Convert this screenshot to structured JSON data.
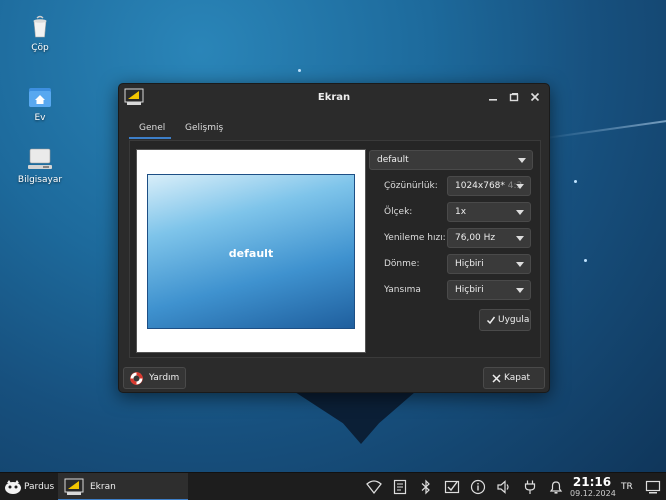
{
  "desktop": {
    "icons": [
      {
        "label": "Çöp",
        "icon": "trash-icon"
      },
      {
        "label": "Ev",
        "icon": "home-folder-icon"
      },
      {
        "label": "Bilgisayar",
        "icon": "computer-icon"
      }
    ]
  },
  "window": {
    "title": "Ekran",
    "tabs": [
      {
        "label": "Genel",
        "active": true
      },
      {
        "label": "Gelişmiş",
        "active": false
      }
    ],
    "preview": {
      "monitor_label": "default"
    },
    "monitor_select": {
      "value": "default"
    },
    "settings": [
      {
        "label": "Çözünürlük:",
        "value": "1024x768*",
        "extra": "4:3"
      },
      {
        "label": "Ölçek:",
        "value": "1x",
        "extra": ""
      },
      {
        "label": "Yenileme hızı:",
        "value": "76,00 Hz",
        "extra": ""
      },
      {
        "label": "Dönme:",
        "value": "Hiçbiri",
        "extra": ""
      },
      {
        "label": "Yansıma",
        "value": "Hiçbiri",
        "extra": ""
      }
    ],
    "apply_label": "Uygula",
    "help_label": "Yardım",
    "close_label": "Kapat"
  },
  "taskbar": {
    "start_label": "Pardus",
    "task_label": "Ekran",
    "time": "21:16",
    "date": "09.12.2024",
    "keyboard_layout": "TR"
  },
  "colors": {
    "accent": "#3d7fc9",
    "window_bg": "#2b2b2b",
    "taskbar_bg": "#1d1d1d"
  }
}
